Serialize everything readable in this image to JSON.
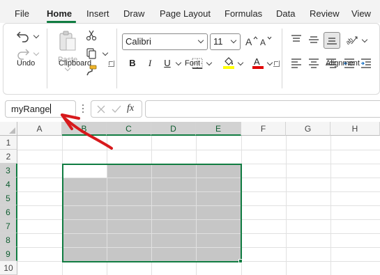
{
  "menu": {
    "tabs": [
      "File",
      "Home",
      "Insert",
      "Draw",
      "Page Layout",
      "Formulas",
      "Data",
      "Review",
      "View"
    ],
    "active_tab": "Home"
  },
  "ribbon": {
    "groups": {
      "undo": "Undo",
      "clipboard": "Clipboard",
      "font": "Font",
      "alignment": "Alignment"
    },
    "paste_label": "Paste",
    "font_name": "Calibri",
    "font_size": "11",
    "bold_label": "B",
    "italic_label": "I",
    "underline_label": "U",
    "font_color_label": "A",
    "highlight_color": "#ffff00",
    "font_color": "#e00000"
  },
  "formula_bar": {
    "name_box_value": "myRange",
    "fx_label": "fx",
    "formula_value": ""
  },
  "sheet": {
    "columns": [
      "A",
      "B",
      "C",
      "D",
      "E",
      "F",
      "G",
      "H"
    ],
    "rows": [
      "1",
      "2",
      "3",
      "4",
      "5",
      "6",
      "7",
      "8",
      "9",
      "10"
    ],
    "selected_columns": [
      "B",
      "C",
      "D",
      "E"
    ],
    "selected_rows": [
      "3",
      "4",
      "5",
      "6",
      "7",
      "8",
      "9"
    ],
    "active_cell": "B3",
    "selected_range": "B3:E9",
    "accent_color": "#107c41"
  },
  "annotation": {
    "arrow_color": "#d7191c",
    "points_to": "name-box"
  }
}
